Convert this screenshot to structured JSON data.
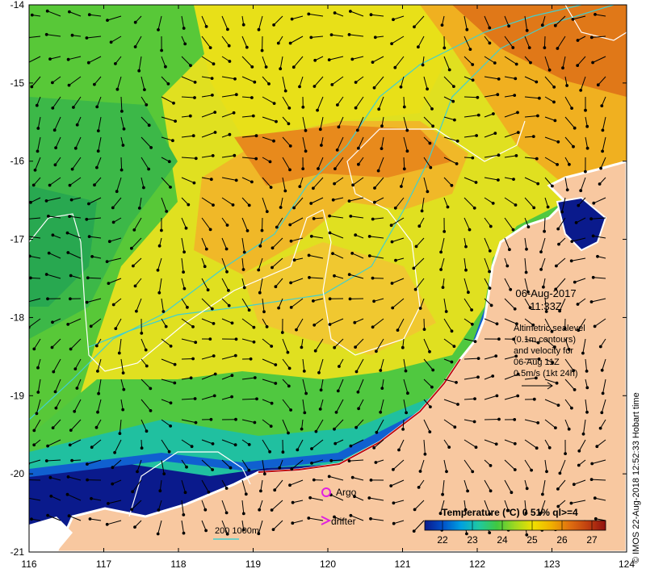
{
  "map": {
    "lon_ticks": [
      "116",
      "117",
      "118",
      "119",
      "120",
      "121",
      "122",
      "123",
      "124"
    ],
    "lat_ticks": [
      "-14",
      "-15",
      "-16",
      "-17",
      "-18",
      "-19",
      "-20",
      "-21"
    ],
    "lon_range": [
      116,
      124
    ],
    "lat_range": [
      -21,
      -14
    ]
  },
  "annotations": {
    "date": "06-Aug-2017",
    "time": "11:33Z",
    "alt_line1": "Altimetric sealevel",
    "alt_line2": "(0.1m contours)",
    "alt_line3": "and velocity for",
    "alt_line4": "06-Aug 11Z",
    "alt_line5": "0.5m/s (1kt 24h)"
  },
  "legend": {
    "argo_label": "Argo",
    "drifter_label": "drifter",
    "depth_label": "200  1000m"
  },
  "colorbar": {
    "title": "Temperature (°C) 0 51% ql>=4",
    "ticks": [
      "22",
      "23",
      "24",
      "25",
      "26",
      "27"
    ],
    "colors": [
      "#0a1a8c",
      "#0050c8",
      "#00a0e0",
      "#20c8a0",
      "#40c840",
      "#a0d820",
      "#f0e000",
      "#f0b000",
      "#e07010",
      "#c04010",
      "#901010"
    ]
  },
  "credit": "© IMOS 22-Aug-2018 12:52:33 Hobart time",
  "palette": {
    "land": "#f8c8a0",
    "deep_blue": "#0a1a8c",
    "bathymetry": "#40d0d0",
    "argo": "#e020e0"
  }
}
